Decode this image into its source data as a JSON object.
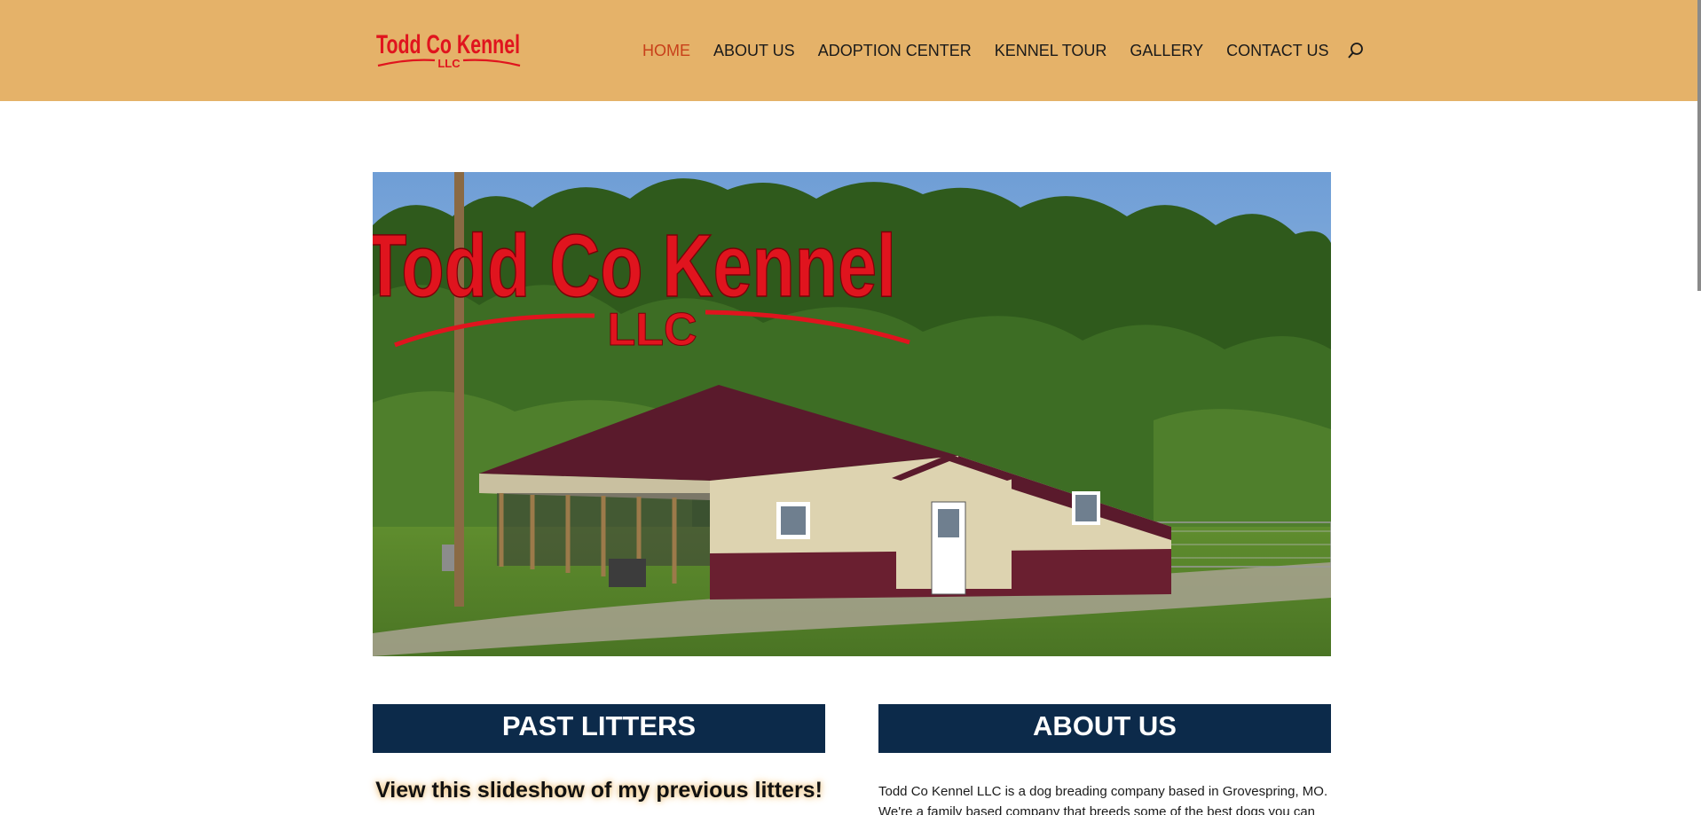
{
  "header": {
    "logo_text": "Todd Co Kennel",
    "logo_sub": "LLC",
    "nav": [
      {
        "label": "HOME",
        "active": true
      },
      {
        "label": "ABOUT US",
        "active": false
      },
      {
        "label": "ADOPTION CENTER",
        "active": false
      },
      {
        "label": "KENNEL TOUR",
        "active": false
      },
      {
        "label": "GALLERY",
        "active": false
      },
      {
        "label": "CONTACT US",
        "active": false
      }
    ]
  },
  "hero": {
    "title": "Todd Co Kennel",
    "subtitle": "LLC"
  },
  "past_litters": {
    "heading": "PAST LITTERS",
    "caption": "View this slideshow of my previous litters!"
  },
  "about": {
    "heading": "ABOUT US",
    "text": "Todd Co Kennel LLC is a dog breading company based in Grovespring, MO. We're a family based company that breeds some of the best dogs you can"
  },
  "colors": {
    "header_bg": "#e5b269",
    "nav_active": "#c8401a",
    "section_bar": "#0c2a4a",
    "logo_red": "#e0141e"
  }
}
